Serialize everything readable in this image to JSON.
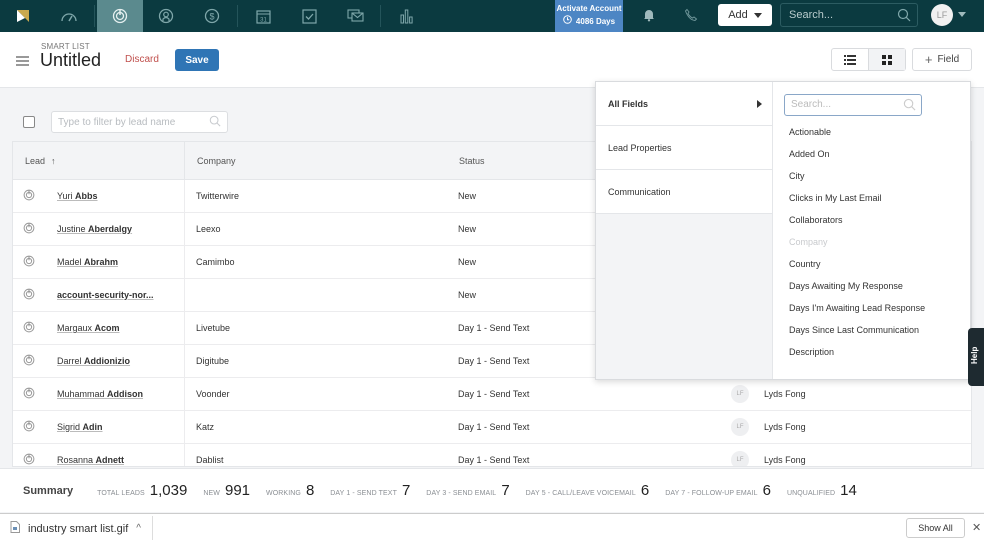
{
  "topbar": {
    "nav_icons": [
      "logo",
      "dashboard-icon",
      "leads-icon",
      "contacts-icon",
      "deals-icon",
      "calendar-icon",
      "tasks-icon",
      "messages-icon",
      "reports-icon"
    ],
    "activate": {
      "title": "Activate Account",
      "days": "4086 Days"
    },
    "add_label": "Add",
    "search_placeholder": "Search...",
    "avatar_initials": "LF"
  },
  "header": {
    "eyebrow": "SMART LIST",
    "title": "Untitled",
    "discard_label": "Discard",
    "save_label": "Save",
    "field_label": "Field"
  },
  "filter": {
    "placeholder": "Type to filter by lead name"
  },
  "table": {
    "columns": [
      "Lead",
      "Company",
      "Status"
    ],
    "sort_indicator": "↑",
    "rows": [
      {
        "first": "Yuri",
        "last": "Abbs",
        "company": "Twitterwire",
        "status": "New",
        "owner": ""
      },
      {
        "first": "Justine",
        "last": "Aberdalgy",
        "company": "Leexo",
        "status": "New",
        "owner": ""
      },
      {
        "first": "Madel",
        "last": "Abrahm",
        "company": "Camimbo",
        "status": "New",
        "owner": ""
      },
      {
        "first": "",
        "last": "account-security-nor...",
        "company": "",
        "status": "New",
        "owner": ""
      },
      {
        "first": "Margaux",
        "last": "Acom",
        "company": "Livetube",
        "status": "Day 1 - Send Text",
        "owner": ""
      },
      {
        "first": "Darrel",
        "last": "Addionizio",
        "company": "Digitube",
        "status": "Day 1 - Send Text",
        "owner": ""
      },
      {
        "first": "Muhammad",
        "last": "Addison",
        "company": "Voonder",
        "status": "Day 1 - Send Text",
        "owner": "Lyds Fong",
        "owner_initials": "LF"
      },
      {
        "first": "Sigrid",
        "last": "Adin",
        "company": "Katz",
        "status": "Day 1 - Send Text",
        "owner": "Lyds Fong",
        "owner_initials": "LF"
      },
      {
        "first": "Rosanna",
        "last": "Adnett",
        "company": "Dablist",
        "status": "Day 1 - Send Text",
        "owner": "Lyds Fong",
        "owner_initials": "LF"
      }
    ]
  },
  "field_dropdown": {
    "categories": [
      "All Fields",
      "Lead Properties",
      "Communication"
    ],
    "search_placeholder": "Search...",
    "items": [
      {
        "label": "Actionable",
        "disabled": false
      },
      {
        "label": "Added On",
        "disabled": false
      },
      {
        "label": "City",
        "disabled": false
      },
      {
        "label": "Clicks in My Last Email",
        "disabled": false
      },
      {
        "label": "Collaborators",
        "disabled": false
      },
      {
        "label": "Company",
        "disabled": true
      },
      {
        "label": "Country",
        "disabled": false
      },
      {
        "label": "Days Awaiting My Response",
        "disabled": false
      },
      {
        "label": "Days I'm Awaiting Lead Response",
        "disabled": false
      },
      {
        "label": "Days Since Last Communication",
        "disabled": false
      },
      {
        "label": "Description",
        "disabled": false
      }
    ]
  },
  "help_label": "Help",
  "summary": {
    "title": "Summary",
    "stats": [
      {
        "label": "TOTAL LEADS",
        "value": "1,039"
      },
      {
        "label": "NEW",
        "value": "991"
      },
      {
        "label": "WORKING",
        "value": "8"
      },
      {
        "label": "DAY 1 - SEND TEXT",
        "value": "7"
      },
      {
        "label": "DAY 3 - SEND EMAIL",
        "value": "7"
      },
      {
        "label": "DAY 5 - CALL/LEAVE VOICEMAIL",
        "value": "6"
      },
      {
        "label": "DAY 7 - FOLLOW-UP EMAIL",
        "value": "6"
      },
      {
        "label": "UNQUALIFIED",
        "value": "14"
      }
    ]
  },
  "download_bar": {
    "filename": "industry smart list.gif",
    "show_all_label": "Show All"
  },
  "colors": {
    "topbar": "#0b3a40",
    "accent_blue": "#2f75b5",
    "discard_red": "#c0504d",
    "activate_blue": "#4d86c4"
  }
}
